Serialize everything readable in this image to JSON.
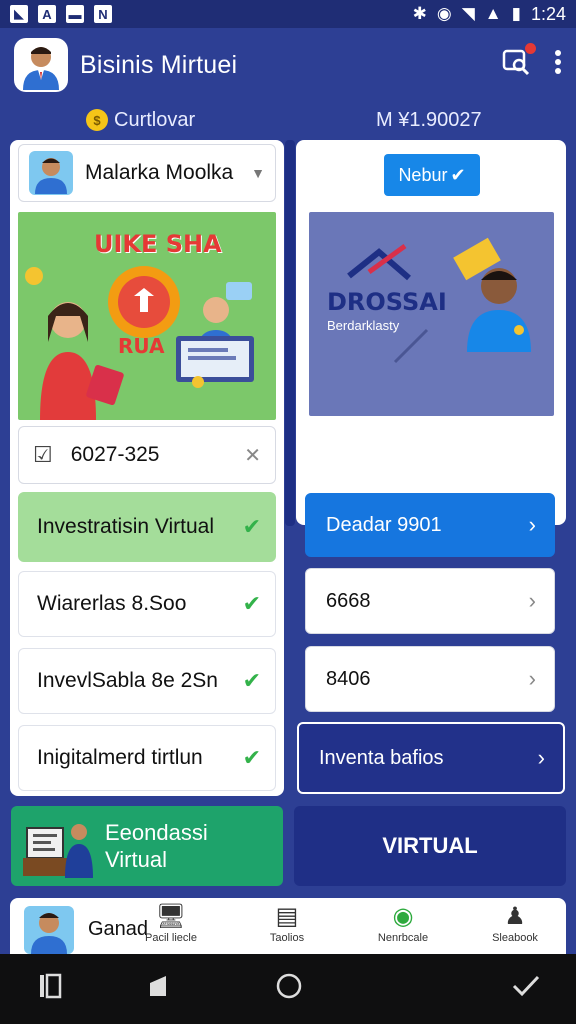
{
  "status": {
    "time": "1:24"
  },
  "app": {
    "title": "Bisinis Mirtuei"
  },
  "balance": {
    "label": "Curtlovar",
    "amount": "M ¥1.90027"
  },
  "left": {
    "dropdown_label": "Malarka Moolka",
    "banner_text": "UIKE SHA",
    "banner_sub": "RUA",
    "code_value": "6027-325",
    "items": [
      "Investratisin Virtual",
      "Wiarerlas 8.Soo",
      "InvevlSabla 8e 2Sn",
      "Inigitalmerd tirtlun"
    ]
  },
  "right": {
    "chip_label": "Nebur",
    "brand": "DROSSAI",
    "brand_sub": "Berdarklasty",
    "items": [
      {
        "label": "Deadar 9901",
        "style": "blue"
      },
      {
        "label": "6668",
        "style": "plain"
      },
      {
        "label": "8406",
        "style": "plain"
      },
      {
        "label": "Inventa bafios",
        "style": "navy"
      }
    ]
  },
  "promo": {
    "green_line1": "Eeondassi",
    "green_line2": "Virtual",
    "virtual": "VIRTUAL"
  },
  "tabs": {
    "user": "Ganad",
    "items": [
      {
        "label": "Pacil liecle",
        "icon": "monitor-icon"
      },
      {
        "label": "Taolios",
        "icon": "document-icon"
      },
      {
        "label": "Nenrbcale",
        "icon": "coin-icon"
      },
      {
        "label": "Sleabook",
        "icon": "person-icon"
      }
    ]
  },
  "colors": {
    "primary": "#2d3f94",
    "accent_blue": "#1676df",
    "green": "#1ea36b",
    "success": "#33b24a"
  }
}
